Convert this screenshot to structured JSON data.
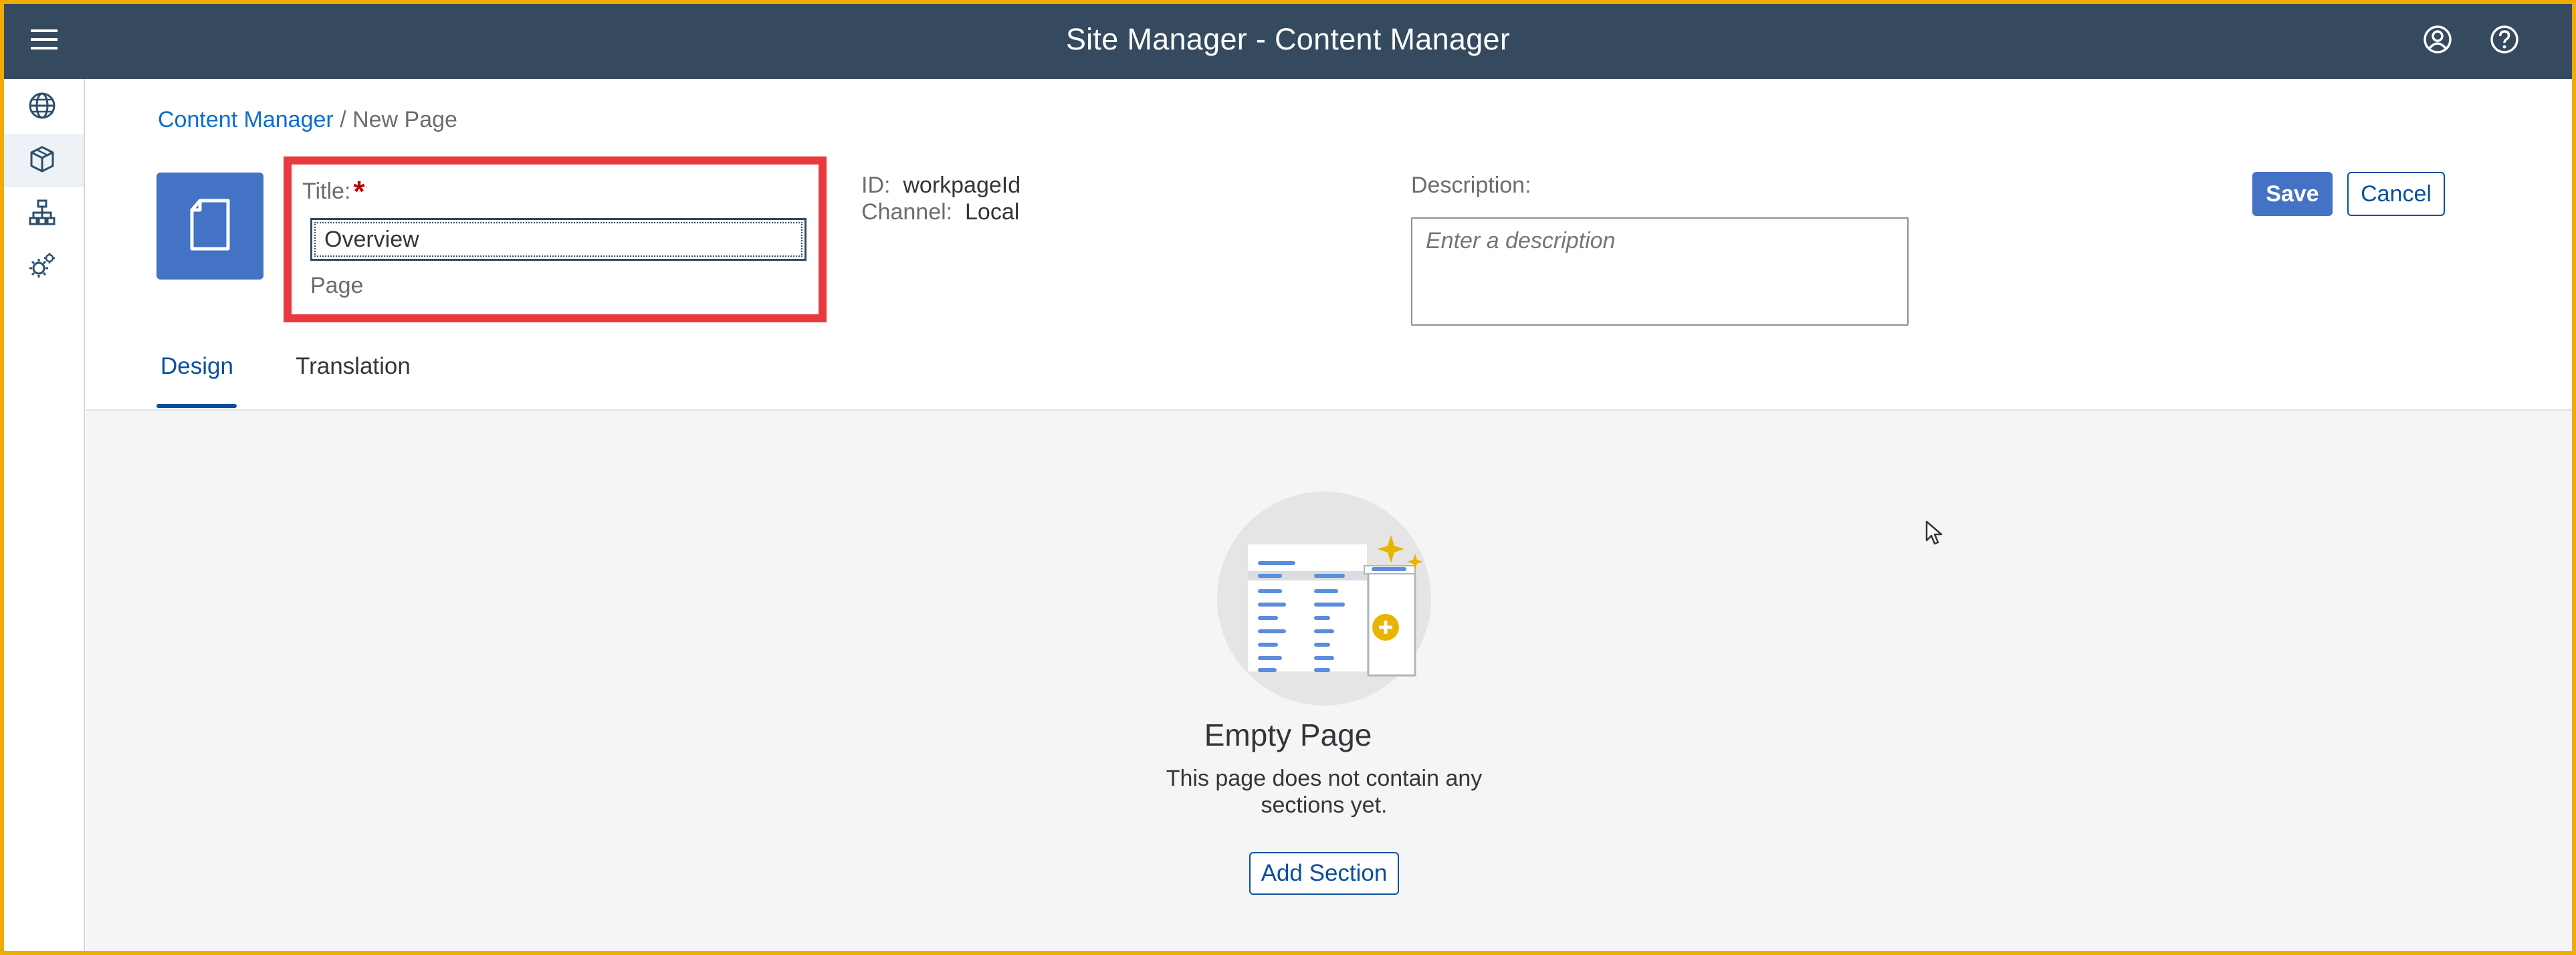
{
  "shell": {
    "title": "Site Manager - Content Manager",
    "menu_icon": "hamburger-menu-icon",
    "profile_icon": "user-profile-icon",
    "help_icon": "help-icon"
  },
  "sidenav": {
    "items": [
      {
        "icon": "globe-icon",
        "active": false
      },
      {
        "icon": "cube-icon",
        "active": true
      },
      {
        "icon": "hierarchy-icon",
        "active": false
      },
      {
        "icon": "settings-gear-icon",
        "active": false
      }
    ]
  },
  "breadcrumb": {
    "link": "Content Manager",
    "separator": "/",
    "current": "New Page"
  },
  "page_header": {
    "title_label": "Title:",
    "required_mark": "*",
    "title_value": "Overview",
    "type_label": "Page",
    "id_label": "ID:",
    "id_value": "workpageId",
    "channel_label": "Channel:",
    "channel_value": "Local",
    "description_label": "Description:",
    "description_placeholder": "Enter a description",
    "save_label": "Save",
    "cancel_label": "Cancel"
  },
  "tabs": [
    {
      "label": "Design",
      "active": true
    },
    {
      "label": "Translation",
      "active": false
    }
  ],
  "empty_state": {
    "title": "Empty Page",
    "text": "This page does not contain any sections yet.",
    "add_label": "Add Section"
  },
  "colors": {
    "shell_bg": "#354a5f",
    "accent": "#4472c4",
    "highlight_border": "#e8393f",
    "frame": "#f0ab00",
    "content_bg": "#f5f5f5"
  }
}
